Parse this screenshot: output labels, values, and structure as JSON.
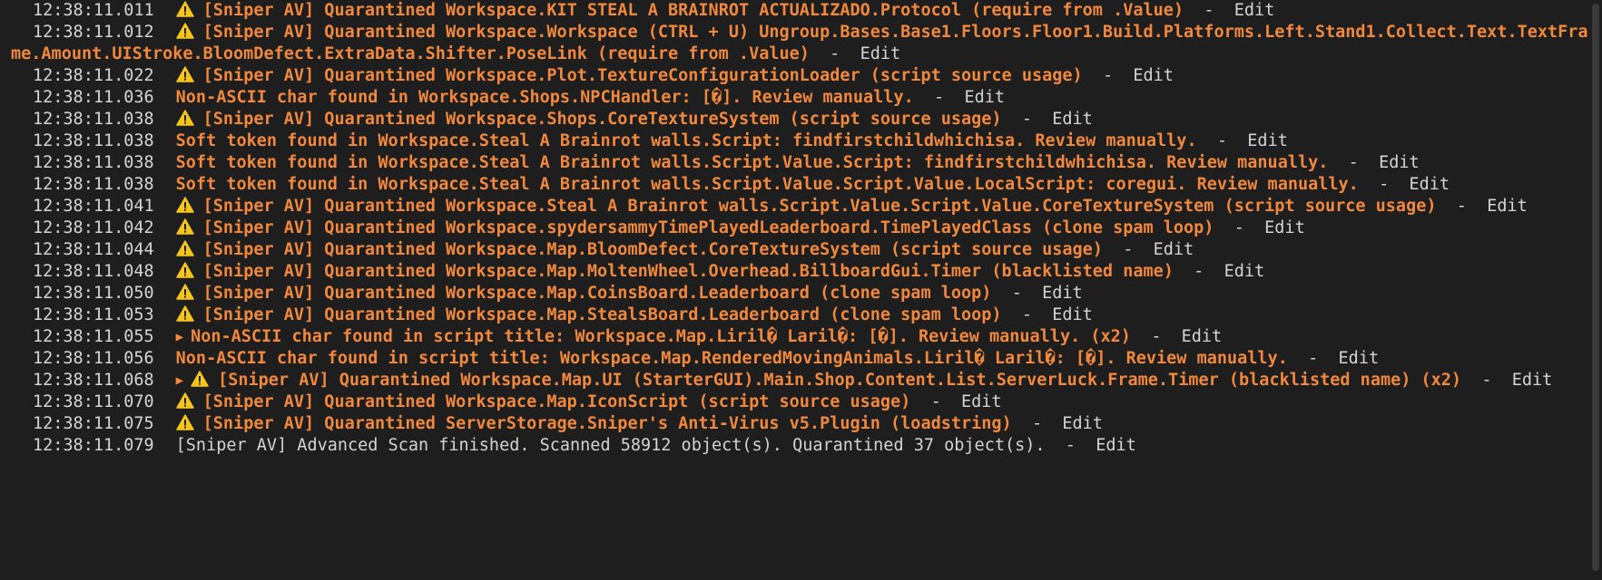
{
  "colors": {
    "background": "#1e1e1e",
    "warning_text": "#f1883d",
    "info_text": "#d4d4d4",
    "warning_icon": "#f5c518"
  },
  "separator": "  -  ",
  "edit_label": "Edit",
  "lines": [
    {
      "time": "12:38:11.011",
      "warn": true,
      "expand": false,
      "kind": "orange",
      "text": "[Sniper AV] Quarantined Workspace.KIT STEAL A BRAINROT ACTUALIZADO.Protocol (require from .Value)"
    },
    {
      "time": "12:38:11.012",
      "warn": true,
      "expand": false,
      "kind": "orange",
      "text": "[Sniper AV] Quarantined Workspace.Workspace (CTRL + U) Ungroup.Bases.Base1.Floors.Floor1.Build.Platforms.Left.Stand1.Collect.Text.TextFrame.Amount.UIStroke.BloomDefect.ExtraData.Shifter.PoseLink (require from .Value)"
    },
    {
      "time": "12:38:11.022",
      "warn": true,
      "expand": false,
      "kind": "orange",
      "text": "[Sniper AV] Quarantined Workspace.Plot.TextureConfigurationLoader (script source usage)"
    },
    {
      "time": "12:38:11.036",
      "warn": false,
      "expand": false,
      "kind": "orange",
      "text": "Non-ASCII char found in Workspace.Shops.NPCHandler: [�]. Review manually."
    },
    {
      "time": "12:38:11.038",
      "warn": true,
      "expand": false,
      "kind": "orange",
      "text": "[Sniper AV] Quarantined Workspace.Shops.CoreTextureSystem (script source usage)"
    },
    {
      "time": "12:38:11.038",
      "warn": false,
      "expand": false,
      "kind": "orange",
      "text": "Soft token found in Workspace.Steal A Brainrot walls.Script: findfirstchildwhichisa. Review manually."
    },
    {
      "time": "12:38:11.038",
      "warn": false,
      "expand": false,
      "kind": "orange",
      "text": "Soft token found in Workspace.Steal A Brainrot walls.Script.Value.Script: findfirstchildwhichisa. Review manually."
    },
    {
      "time": "12:38:11.038",
      "warn": false,
      "expand": false,
      "kind": "orange",
      "text": "Soft token found in Workspace.Steal A Brainrot walls.Script.Value.Script.Value.LocalScript: coregui. Review manually."
    },
    {
      "time": "12:38:11.041",
      "warn": true,
      "expand": false,
      "kind": "orange",
      "text": "[Sniper AV] Quarantined Workspace.Steal A Brainrot walls.Script.Value.Script.Value.CoreTextureSystem (script source usage)"
    },
    {
      "time": "12:38:11.042",
      "warn": true,
      "expand": false,
      "kind": "orange",
      "text": "[Sniper AV] Quarantined Workspace.spydersammyTimePlayedLeaderboard.TimePlayedClass (clone spam loop)"
    },
    {
      "time": "12:38:11.044",
      "warn": true,
      "expand": false,
      "kind": "orange",
      "text": "[Sniper AV] Quarantined Workspace.Map.BloomDefect.CoreTextureSystem (script source usage)"
    },
    {
      "time": "12:38:11.048",
      "warn": true,
      "expand": false,
      "kind": "orange",
      "text": "[Sniper AV] Quarantined Workspace.Map.MoltenWheel.Overhead.BillboardGui.Timer (blacklisted name)"
    },
    {
      "time": "12:38:11.050",
      "warn": true,
      "expand": false,
      "kind": "orange",
      "text": "[Sniper AV] Quarantined Workspace.Map.CoinsBoard.Leaderboard (clone spam loop)"
    },
    {
      "time": "12:38:11.053",
      "warn": true,
      "expand": false,
      "kind": "orange",
      "text": "[Sniper AV] Quarantined Workspace.Map.StealsBoard.Leaderboard (clone spam loop)"
    },
    {
      "time": "12:38:11.055",
      "warn": false,
      "expand": true,
      "kind": "orange",
      "text": "Non-ASCII char found in script title: Workspace.Map.Liril� Laril�: [�]. Review manually. (x2)"
    },
    {
      "time": "12:38:11.056",
      "warn": false,
      "expand": false,
      "kind": "orange",
      "text": "Non-ASCII char found in script title: Workspace.Map.RenderedMovingAnimals.Liril� Laril�: [�]. Review manually."
    },
    {
      "time": "12:38:11.068",
      "warn": true,
      "expand": true,
      "kind": "orange",
      "text": "[Sniper AV] Quarantined Workspace.Map.UI (StarterGUI).Main.Shop.Content.List.ServerLuck.Frame.Timer (blacklisted name) (x2)"
    },
    {
      "time": "12:38:11.070",
      "warn": true,
      "expand": false,
      "kind": "orange",
      "text": "[Sniper AV] Quarantined Workspace.Map.IconScript (script source usage)"
    },
    {
      "time": "12:38:11.075",
      "warn": true,
      "expand": false,
      "kind": "orange",
      "text": "[Sniper AV] Quarantined ServerStorage.Sniper's Anti-Virus v5.Plugin (loadstring)"
    },
    {
      "time": "12:38:11.079",
      "warn": false,
      "expand": false,
      "kind": "white",
      "text": "[Sniper AV] Advanced Scan finished. Scanned 58912 object(s). Quarantined 37 object(s)."
    }
  ]
}
